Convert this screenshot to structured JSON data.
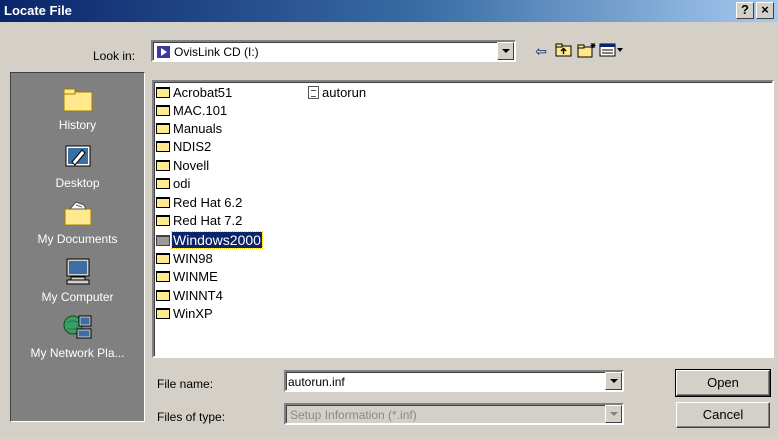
{
  "window": {
    "title": "Locate File",
    "help_label": "?",
    "close_label": "×"
  },
  "lookin": {
    "label": "Look in:",
    "value": "OvisLink CD (I:)"
  },
  "toolbar": {
    "back_icon": "back-arrow-icon",
    "up_icon": "up-folder-icon",
    "new_folder_icon": "new-folder-icon",
    "views_icon": "views-menu-icon"
  },
  "places": [
    {
      "label": "History",
      "icon": "history-folder-icon"
    },
    {
      "label": "Desktop",
      "icon": "desktop-icon"
    },
    {
      "label": "My Documents",
      "icon": "my-documents-icon"
    },
    {
      "label": "My Computer",
      "icon": "my-computer-icon"
    },
    {
      "label": "My Network Pla...",
      "icon": "network-places-icon"
    }
  ],
  "files": [
    {
      "name": "Acrobat51",
      "type": "folder"
    },
    {
      "name": "MAC.101",
      "type": "folder"
    },
    {
      "name": "Manuals",
      "type": "folder"
    },
    {
      "name": "NDIS2",
      "type": "folder"
    },
    {
      "name": "Novell",
      "type": "folder"
    },
    {
      "name": "odi",
      "type": "folder"
    },
    {
      "name": "Red Hat 6.2",
      "type": "folder"
    },
    {
      "name": "Red Hat 7.2",
      "type": "folder"
    },
    {
      "name": "Windows2000",
      "type": "folder",
      "selected": true
    },
    {
      "name": "WIN98",
      "type": "folder"
    },
    {
      "name": "WINME",
      "type": "folder"
    },
    {
      "name": "WINNT4",
      "type": "folder"
    },
    {
      "name": "WinXP",
      "type": "folder"
    },
    {
      "name": "autorun",
      "type": "file"
    }
  ],
  "filename": {
    "label": "File name:",
    "value": "autorun.inf"
  },
  "filetype": {
    "label": "Files of type:",
    "value": "Setup Information (*.inf)"
  },
  "buttons": {
    "open": "Open",
    "cancel": "Cancel"
  },
  "colors": {
    "titlebar": "#0a246a",
    "face": "#d4d0c8",
    "places_bg": "#808080",
    "selection": "#0a246a"
  }
}
